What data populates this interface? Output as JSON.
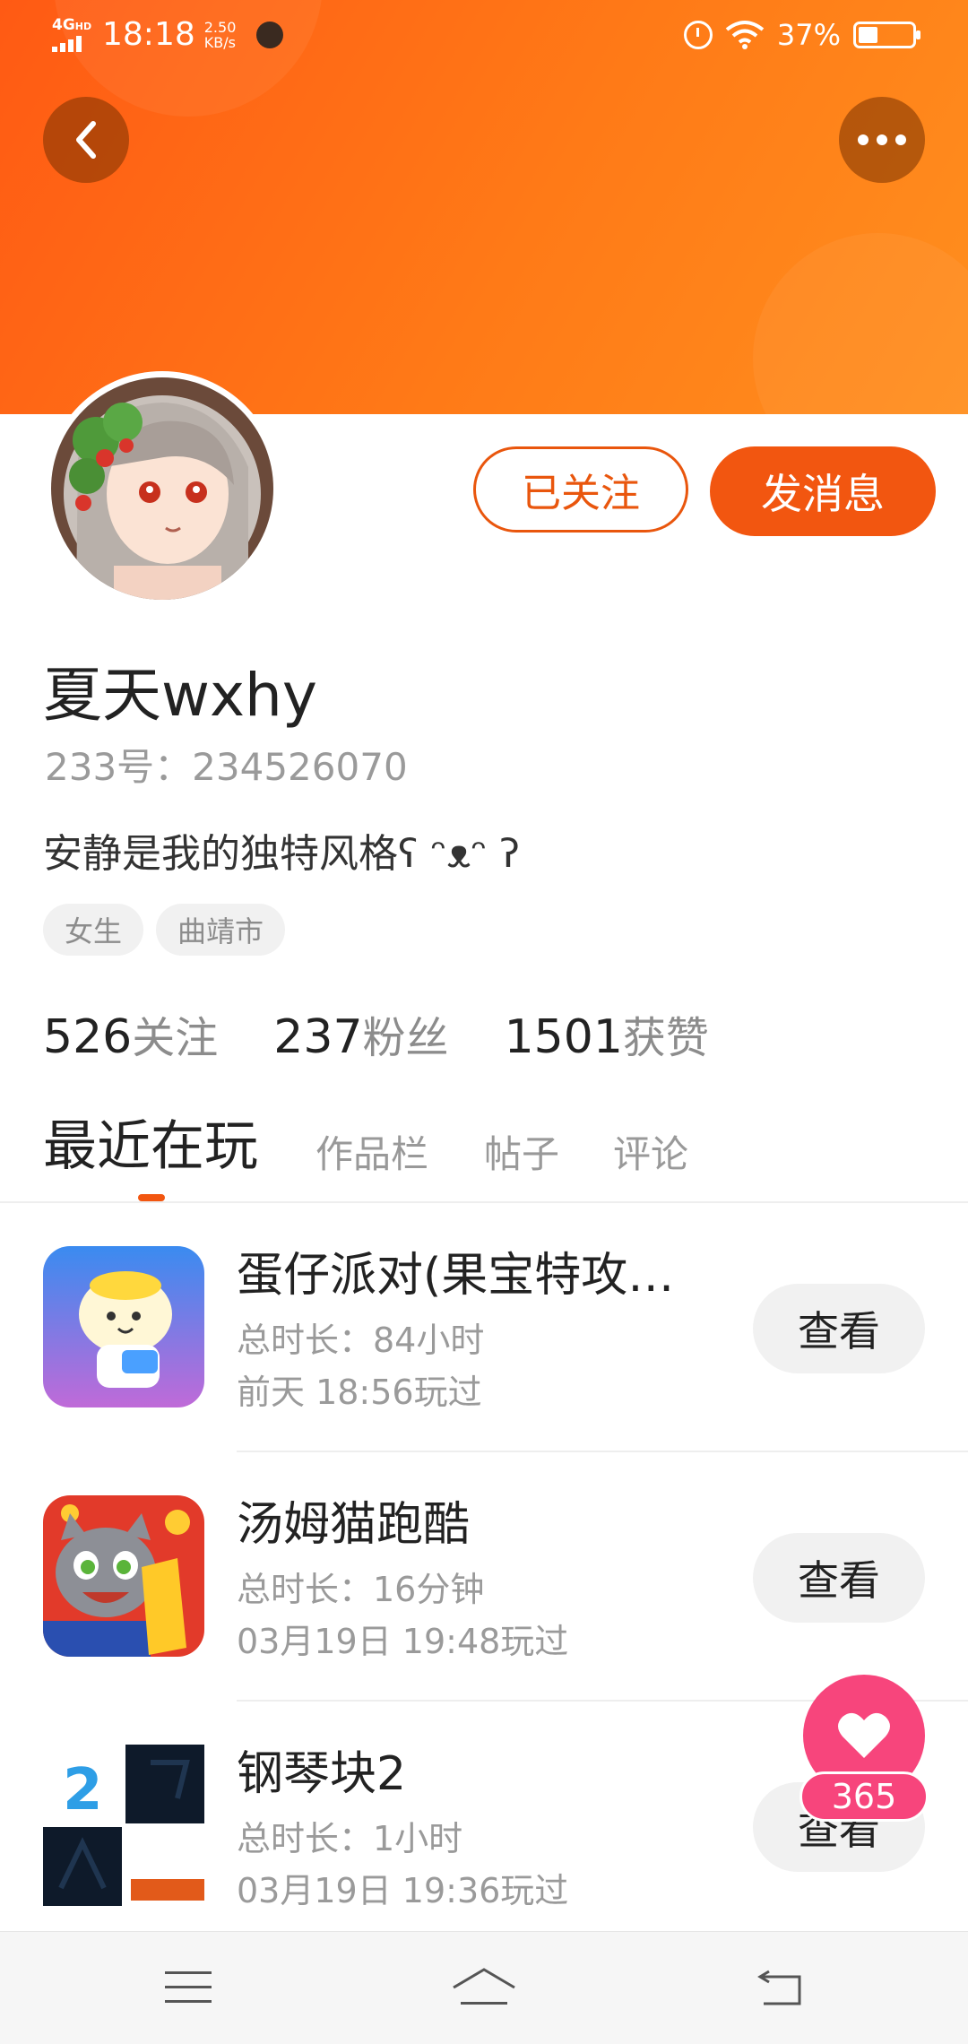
{
  "status_bar": {
    "network": "4G",
    "network_sub": "HD",
    "time": "18:18",
    "speed_value": "2.50",
    "speed_unit": "KB/s",
    "battery_pct": "37%",
    "battery_level": 0.37
  },
  "header": {
    "back_icon": "chevron-left-icon",
    "more_icon": "more-dots-icon",
    "colors": {
      "banner": "#ff7a17",
      "accent": "#f25610"
    }
  },
  "profile": {
    "name": "夏天wxhy",
    "id_line": "233号：234526070",
    "bio": "安静是我的独特风格ʕ ᵔᴥᵔ ʔ",
    "tags": [
      "女生",
      "曲靖市"
    ],
    "follow_label": "已关注",
    "message_label": "发消息"
  },
  "stats": [
    {
      "value": "526",
      "label": "关注"
    },
    {
      "value": "237",
      "label": "粉丝"
    },
    {
      "value": "1501",
      "label": "获赞"
    }
  ],
  "tabs": [
    {
      "label": "最近在玩",
      "active": true
    },
    {
      "label": "作品栏",
      "active": false
    },
    {
      "label": "帖子",
      "active": false
    },
    {
      "label": "评论",
      "active": false
    }
  ],
  "games": [
    {
      "title": "蛋仔派对(果宝特攻…",
      "duration": "总时长：84小时",
      "played": "前天 18:56玩过",
      "button": "查看"
    },
    {
      "title": "汤姆猫跑酷",
      "duration": "总时长：16分钟",
      "played": "03月19日 19:48玩过",
      "button": "查看"
    },
    {
      "title": "钢琴块2",
      "duration": "总时长：1小时",
      "played": "03月19日 19:36玩过",
      "button": "查看"
    }
  ],
  "like_fab": {
    "icon": "heart-icon",
    "count": "365"
  },
  "navbar": {
    "menu_icon": "menu-icon",
    "home_icon": "home-icon",
    "back_icon": "return-icon"
  }
}
